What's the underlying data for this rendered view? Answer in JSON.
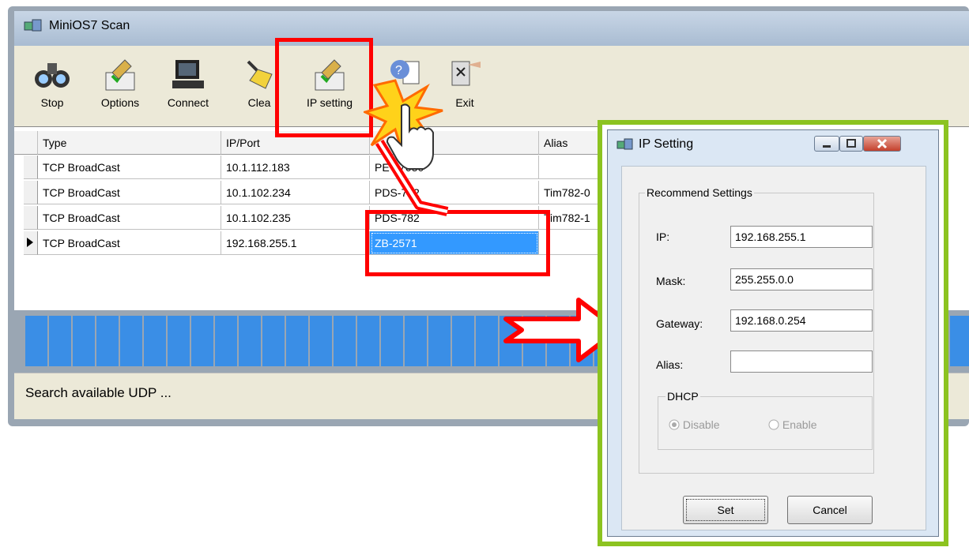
{
  "main": {
    "title": "MiniOS7 Scan",
    "toolbar": {
      "buttons": [
        {
          "label": "Stop",
          "icon": "binoculars-icon"
        },
        {
          "label": "Options",
          "icon": "options-icon"
        },
        {
          "label": "Connect",
          "icon": "computer-icon"
        },
        {
          "label": "Clea",
          "icon": "broom-icon"
        },
        {
          "label": "IP setting",
          "icon": "ip-setting-icon"
        },
        {
          "label": "",
          "icon": "help-icon"
        },
        {
          "label": "Exit",
          "icon": "exit-icon"
        }
      ]
    },
    "grid": {
      "headers": [
        "Type",
        "IP/Port",
        "",
        "Alias"
      ],
      "rows": [
        {
          "type": "TCP BroadCast",
          "ip": "10.1.112.183",
          "name": "PET-7050",
          "alias": ""
        },
        {
          "type": "TCP BroadCast",
          "ip": "10.1.102.234",
          "name": "PDS-782",
          "alias": "Tim782-0"
        },
        {
          "type": "TCP BroadCast",
          "ip": "10.1.102.235",
          "name": "PDS-782",
          "alias": "Tim782-1"
        },
        {
          "type": "TCP BroadCast",
          "ip": "192.168.255.1",
          "name": "ZB-2571",
          "alias": ""
        }
      ],
      "selected_row": 3
    },
    "status": "Search available UDP ..."
  },
  "dialog": {
    "title": "IP Setting",
    "group_label": "Recommend Settings",
    "fields": {
      "ip_label": "IP:",
      "ip_value": "192.168.255.1",
      "mask_label": "Mask:",
      "mask_value": "255.255.0.0",
      "gateway_label": "Gateway:",
      "gateway_value": "192.168.0.254",
      "alias_label": "Alias:",
      "alias_value": ""
    },
    "dhcp": {
      "label": "DHCP",
      "disable": "Disable",
      "enable": "Enable",
      "selected": "Disable"
    },
    "set_label": "Set",
    "cancel_label": "Cancel"
  },
  "colors": {
    "highlight_red": "#ff0000",
    "dialog_frame_green": "#8cc320",
    "progress_blue": "#3a8ee6",
    "selection_blue": "#3399ff"
  }
}
